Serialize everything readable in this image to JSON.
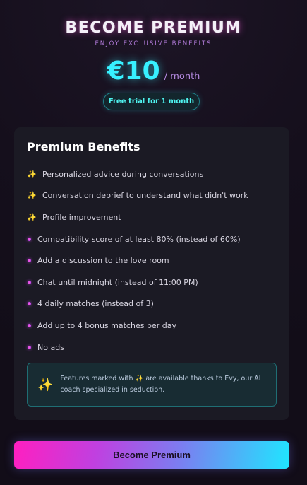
{
  "header": {
    "title": "BECOME PREMIUM",
    "subtitle": "ENJOY EXCLUSIVE BENEFITS",
    "price": "€10",
    "period": "/ month",
    "trial_badge": "Free trial for 1 month"
  },
  "card": {
    "title": "Premium Benefits",
    "benefits": [
      {
        "label": "Personalized advice during conversations",
        "icon": "sparkle-icon"
      },
      {
        "label": "Conversation debrief to understand what didn't work",
        "icon": "sparkle-icon"
      },
      {
        "label": "Profile improvement",
        "icon": "sparkle-icon"
      },
      {
        "label": "Compatibility score of at least 80% (instead of 60%)",
        "icon": "bullet-dot"
      },
      {
        "label": "Add a discussion to the love room",
        "icon": "bullet-dot"
      },
      {
        "label": "Chat until midnight (instead of 11:00 PM)",
        "icon": "bullet-dot"
      },
      {
        "label": "4 daily matches (instead of 3)",
        "icon": "bullet-dot"
      },
      {
        "label": "Add up to 4 bonus matches per day",
        "icon": "bullet-dot"
      },
      {
        "label": "No ads",
        "icon": "bullet-dot"
      }
    ],
    "note": {
      "line1": "Features marked with ✨ are available thanks to Evy, our AI",
      "line2": "coach specialized in seduction."
    }
  },
  "cta": {
    "label": "Become Premium"
  },
  "colors": {
    "accent_cyan": "#37f0ff",
    "accent_pink": "#ff1fc0",
    "card_bg": "#1b1a24",
    "page_bg": "#150f1c"
  }
}
